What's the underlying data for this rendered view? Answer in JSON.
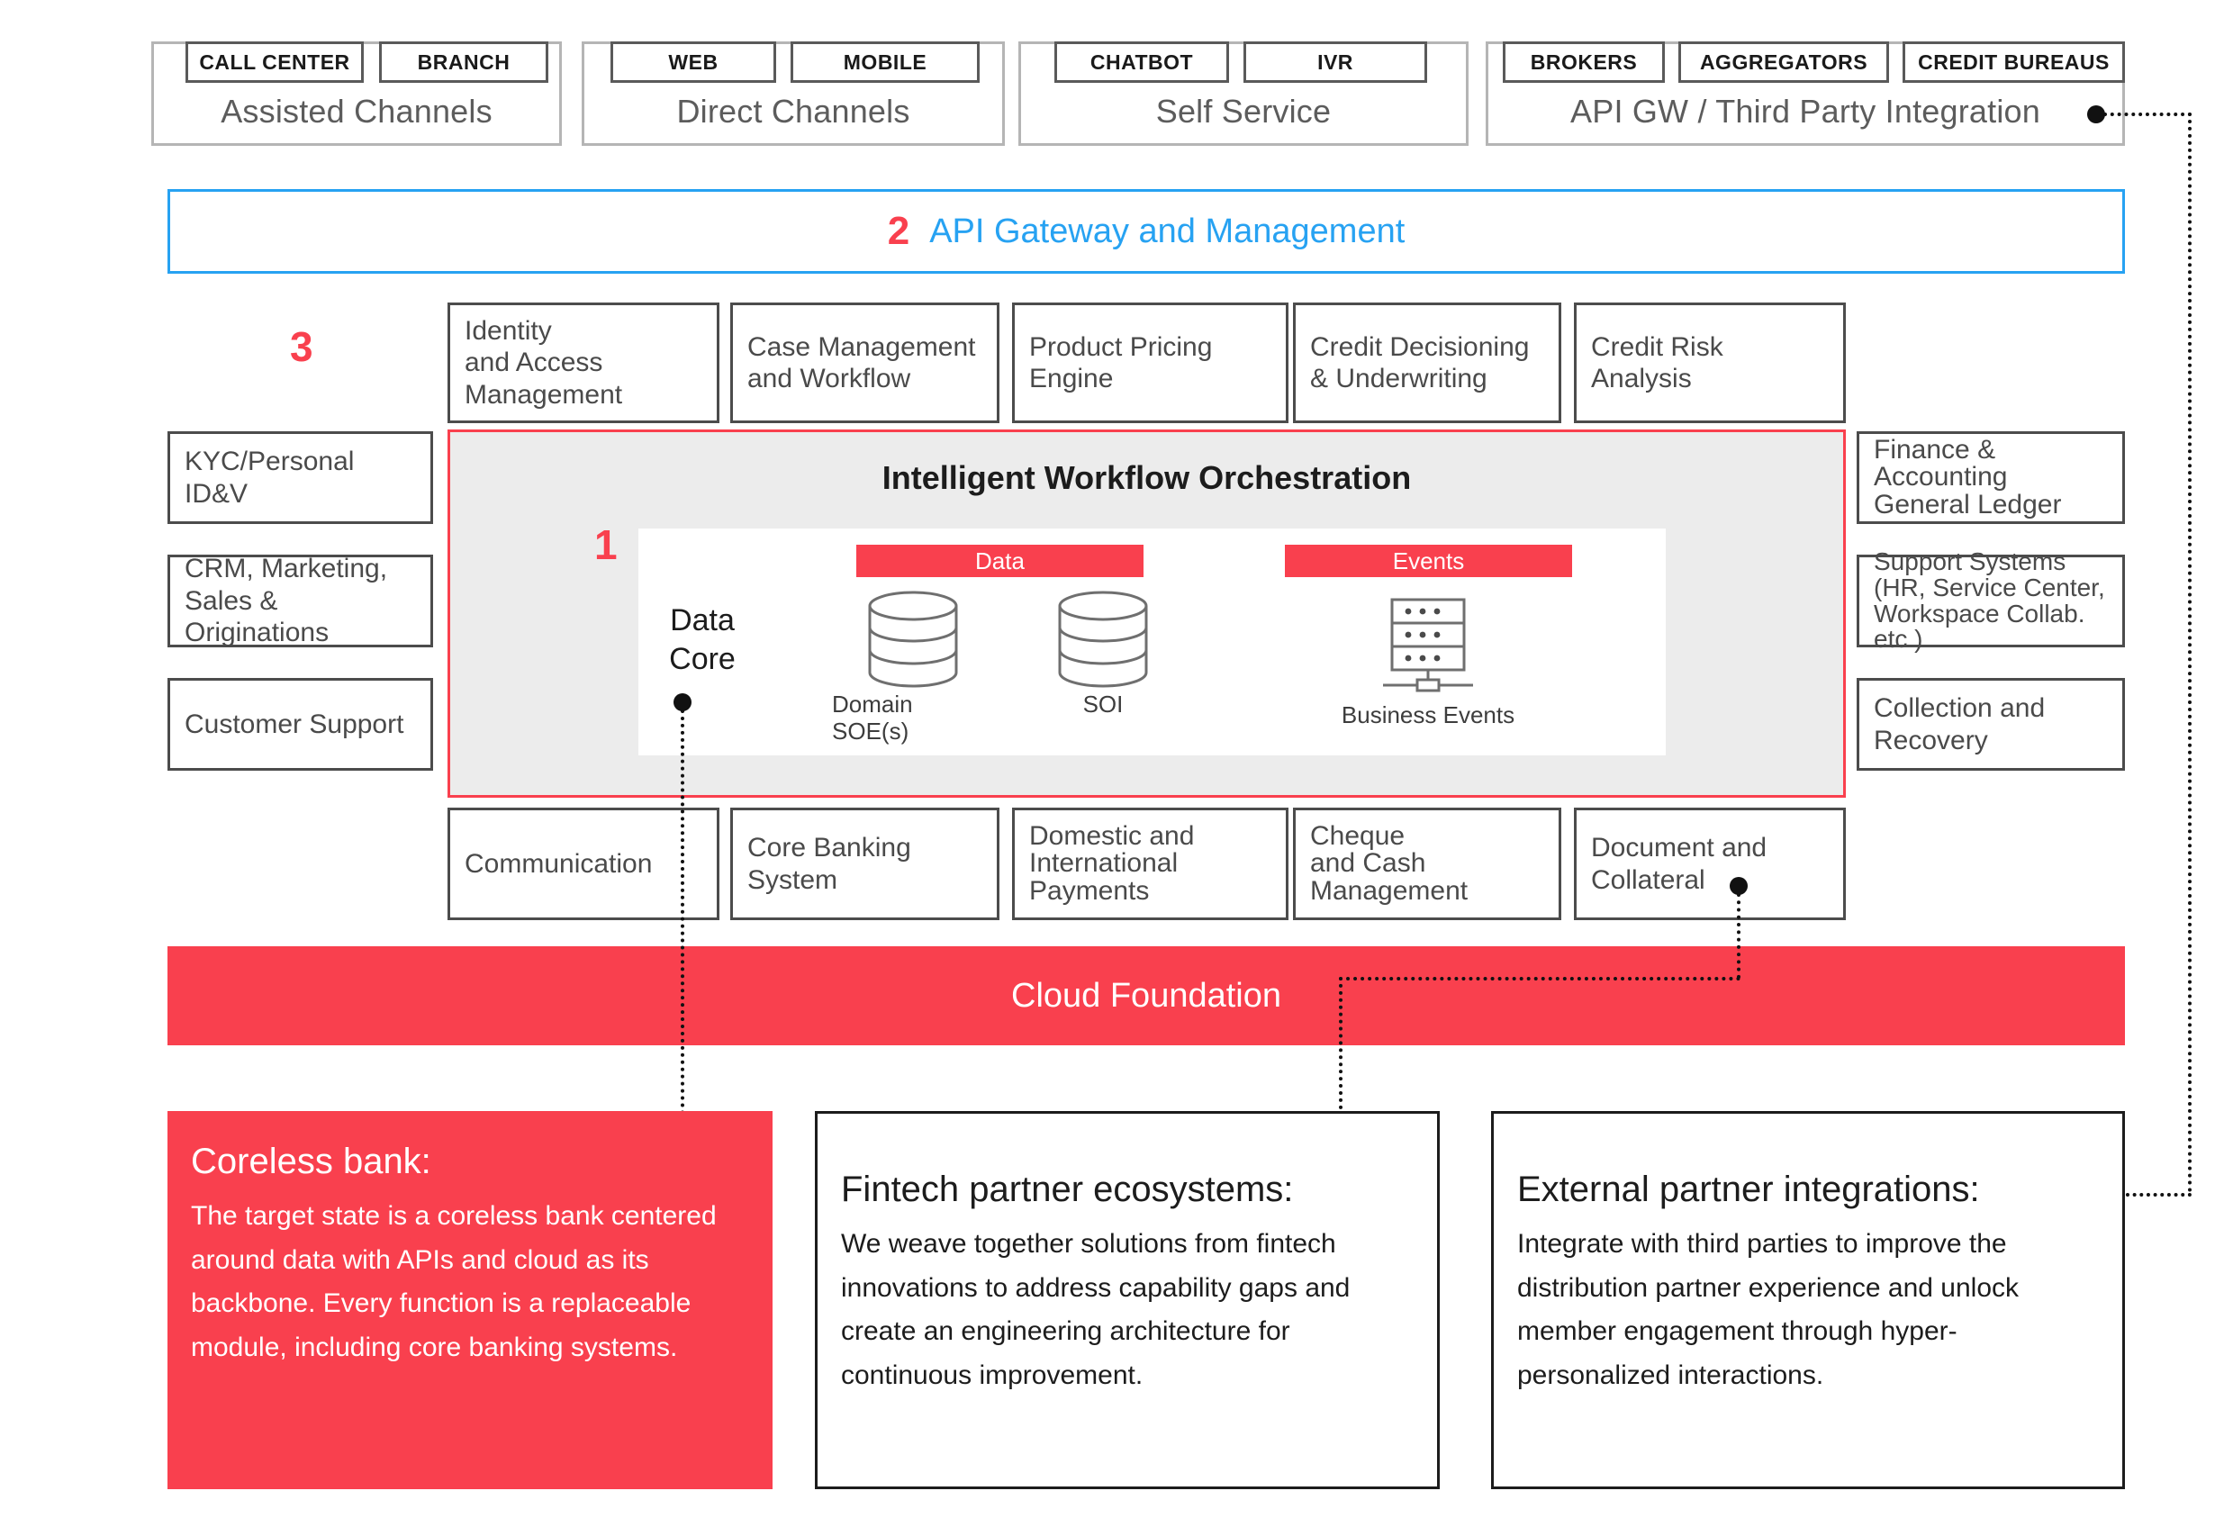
{
  "channel_groups": [
    {
      "label": "Assisted Channels",
      "pills": [
        "CALL CENTER",
        "BRANCH"
      ]
    },
    {
      "label": "Direct Channels",
      "pills": [
        "WEB",
        "MOBILE"
      ]
    },
    {
      "label": "Self Service",
      "pills": [
        "CHATBOT",
        "IVR"
      ]
    },
    {
      "label": "API GW / Third Party Integration",
      "pills": [
        "BROKERS",
        "AGGREGATORS",
        "CREDIT BUREAUS"
      ]
    }
  ],
  "api_gateway": {
    "number": "2",
    "label": "API Gateway and Management",
    "border_color": "#27a2f2",
    "number_color": "#f9404e"
  },
  "layer_marker_3": "3",
  "top_capabilities": [
    "Identity\nand Access\nManagement",
    "Case Management\nand Workflow",
    "Product Pricing\nEngine",
    "Credit Decisioning\n& Underwriting",
    "Credit Risk Analysis"
  ],
  "left_capabilities": [
    "KYC/Personal\nID&V",
    "CRM, Marketing,\nSales & Originations",
    "Customer Support"
  ],
  "right_capabilities": [
    "Finance &\nAccounting\nGeneral Ledger",
    "Support Systems\n(HR, Service Center,\nWorkspace Collab.\netc.)",
    "Collection and\nRecovery"
  ],
  "bottom_capabilities": [
    "Communication",
    "Core Banking\nSystem",
    "Domestic and\nInternational\nPayments",
    "Cheque\nand Cash\nManagement",
    "Document and\nCollateral"
  ],
  "orchestration": {
    "number": "1",
    "title": "Intelligent Workflow Orchestration",
    "data_core_label": "Data\nCore",
    "groups": [
      {
        "header": "Data",
        "items": [
          {
            "caption": "Domain\nSOE(s)",
            "icon": "database-icon"
          },
          {
            "caption": "SOI",
            "icon": "database-icon"
          }
        ]
      },
      {
        "header": "Events",
        "items": [
          {
            "caption": "Business Events",
            "icon": "server-rack-icon"
          }
        ]
      }
    ],
    "accent_color": "#f9404e"
  },
  "cloud_foundation": {
    "label": "Cloud Foundation",
    "color": "#f9404e"
  },
  "callouts": [
    {
      "title": "Coreless bank:",
      "body": "The target state is a coreless bank centered around data with APIs and cloud as its backbone. Every function is a replaceable module, including core banking systems.",
      "style": "red"
    },
    {
      "title": "Fintech partner ecosystems:",
      "body": "We weave together solutions from fintech innovations to address capability gaps and create an engineering architecture for continuous improvement.",
      "style": "plain"
    },
    {
      "title": "External partner integrations:",
      "body": "Integrate with third parties to improve the distribution partner experience and unlock member engagement through hyper-personalized interactions.",
      "style": "plain"
    }
  ]
}
